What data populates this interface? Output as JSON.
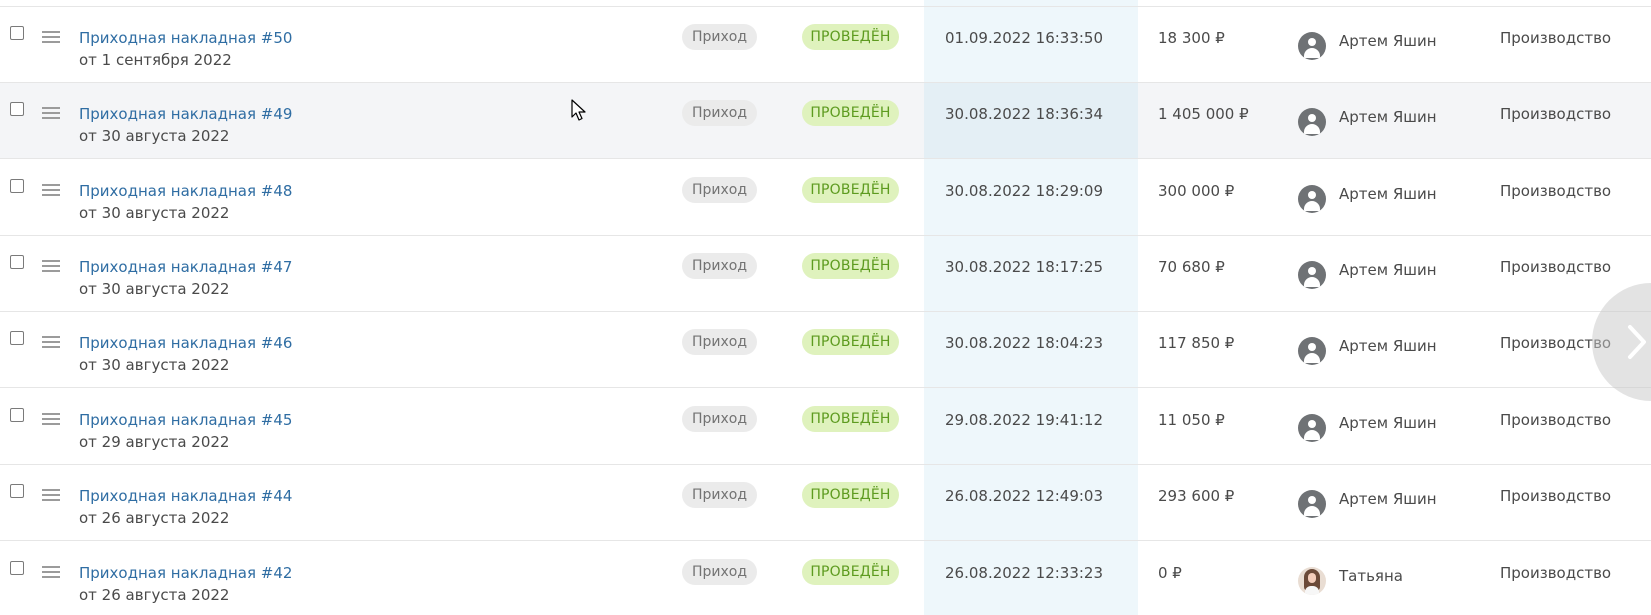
{
  "rows": [
    {
      "title": "Приходная накладная #50",
      "subtitle": "от 1 сентября 2022",
      "type": "Приход",
      "status": "ПРОВЕДЁН",
      "date": "01.09.2022 16:33:50",
      "amount": "18 300 ₽",
      "author": "Артем Яшин",
      "warehouse": "Производство"
    },
    {
      "title": "Приходная накладная #49",
      "subtitle": "от 30 августа 2022",
      "type": "Приход",
      "status": "ПРОВЕДЁН",
      "date": "30.08.2022 18:36:34",
      "amount": "1 405 000 ₽",
      "author": "Артем Яшин",
      "warehouse": "Производство"
    },
    {
      "title": "Приходная накладная #48",
      "subtitle": "от 30 августа 2022",
      "type": "Приход",
      "status": "ПРОВЕДЁН",
      "date": "30.08.2022 18:29:09",
      "amount": "300 000 ₽",
      "author": "Артем Яшин",
      "warehouse": "Производство"
    },
    {
      "title": "Приходная накладная #47",
      "subtitle": "от 30 августа 2022",
      "type": "Приход",
      "status": "ПРОВЕДЁН",
      "date": "30.08.2022 18:17:25",
      "amount": "70 680 ₽",
      "author": "Артем Яшин",
      "warehouse": "Производство"
    },
    {
      "title": "Приходная накладная #46",
      "subtitle": "от 30 августа 2022",
      "type": "Приход",
      "status": "ПРОВЕДЁН",
      "date": "30.08.2022 18:04:23",
      "amount": "117 850 ₽",
      "author": "Артем Яшин",
      "warehouse": "Производство"
    },
    {
      "title": "Приходная накладная #45",
      "subtitle": "от 29 августа 2022",
      "type": "Приход",
      "status": "ПРОВЕДЁН",
      "date": "29.08.2022 19:41:12",
      "amount": "11 050 ₽",
      "author": "Артем Яшин",
      "warehouse": "Производство"
    },
    {
      "title": "Приходная накладная #44",
      "subtitle": "от 26 августа 2022",
      "type": "Приход",
      "status": "ПРОВЕДЁН",
      "date": "26.08.2022 12:49:03",
      "amount": "293 600 ₽",
      "author": "Артем Яшин",
      "warehouse": "Производство"
    },
    {
      "title": "Приходная накладная #42",
      "subtitle": "от 26 августа 2022",
      "type": "Приход",
      "status": "ПРОВЕДЁН",
      "date": "26.08.2022 12:33:23",
      "amount": "0 ₽",
      "author": "Татьяна",
      "warehouse": "Производство"
    }
  ],
  "icons": {
    "checkbox": "checkbox",
    "drag_handle": "drag-handle-icon",
    "avatar_default": "user-avatar-icon",
    "next": "chevron-right-icon",
    "cursor": "mouse-pointer-icon"
  },
  "colors": {
    "link": "#2f6da3",
    "status_bg": "#dff2bd",
    "status_text": "#5d9b1f",
    "type_bg": "#ebebeb",
    "date_column_bg": "#eef7fb"
  }
}
